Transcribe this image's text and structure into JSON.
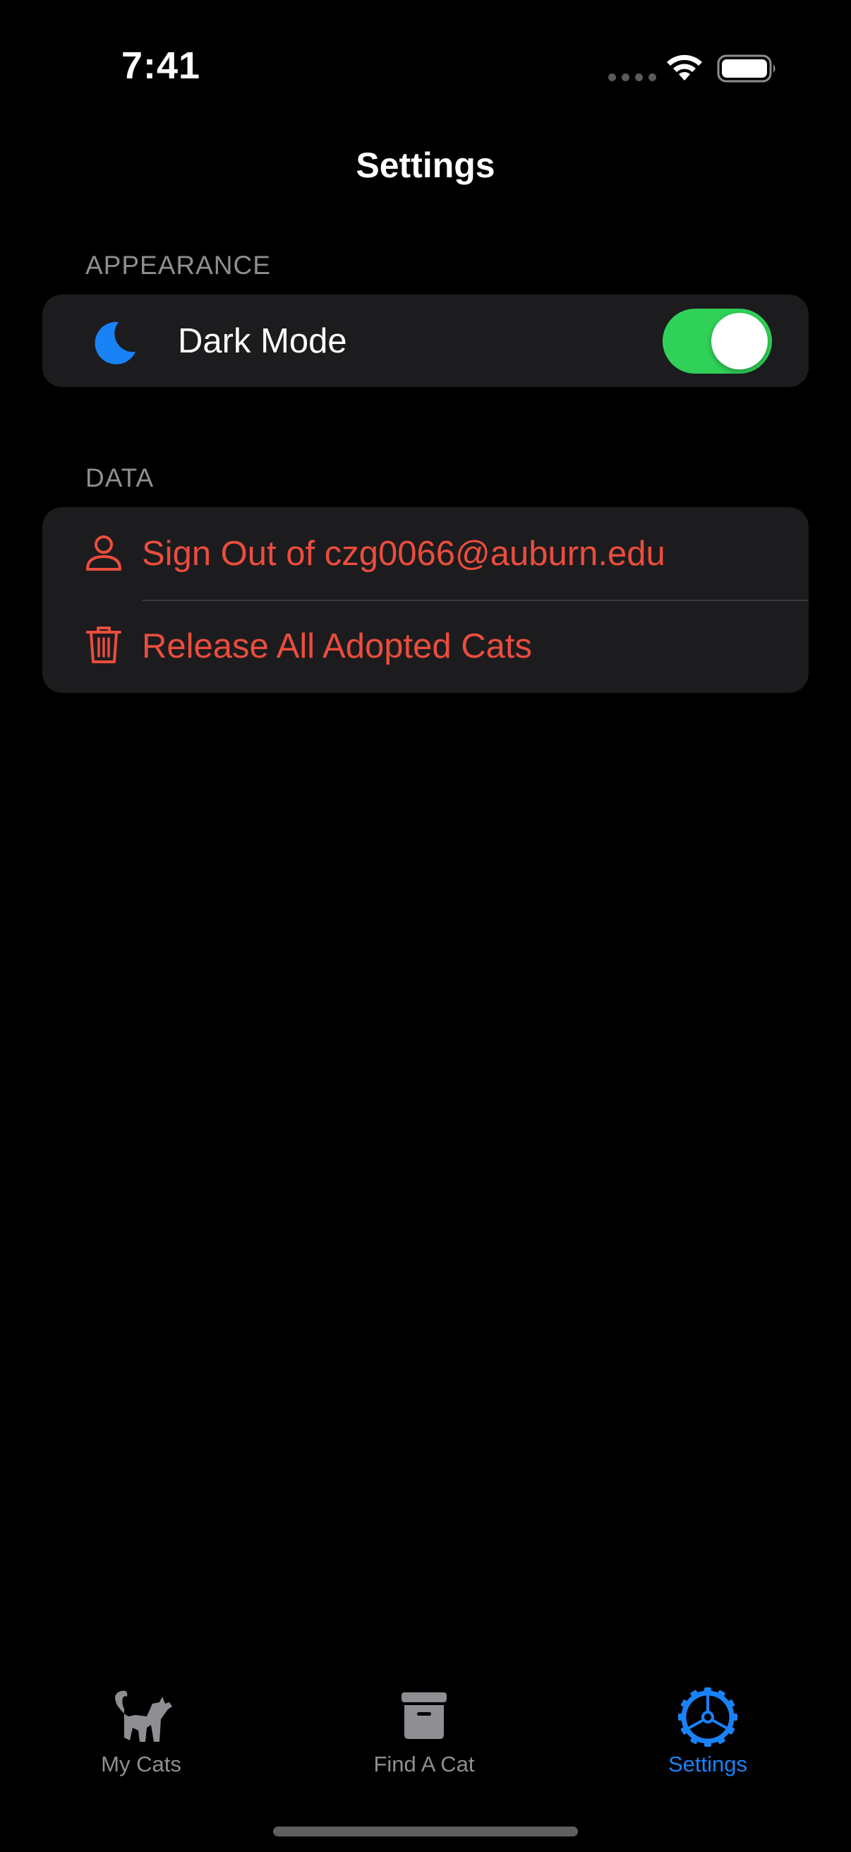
{
  "status_bar": {
    "time": "7:41"
  },
  "nav": {
    "title": "Settings"
  },
  "sections": {
    "appearance": {
      "header": "APPEARANCE",
      "dark_mode": {
        "label": "Dark Mode",
        "icon": "moon-icon",
        "enabled": true
      }
    },
    "data": {
      "header": "DATA",
      "sign_out": {
        "label": "Sign Out of czg0066@auburn.edu",
        "icon": "person-icon"
      },
      "release": {
        "label": "Release All Adopted Cats",
        "icon": "trash-icon"
      }
    }
  },
  "tab_bar": {
    "tabs": [
      {
        "label": "My Cats",
        "icon": "cat-icon",
        "selected": false
      },
      {
        "label": "Find A Cat",
        "icon": "archive-box-icon",
        "selected": false
      },
      {
        "label": "Settings",
        "icon": "gear-icon",
        "selected": true
      }
    ]
  },
  "colors": {
    "background": "#000000",
    "group_background": "#1c1c1e",
    "destructive": "#eb4d3d",
    "accent": "#1a82f7",
    "toggle_on": "#30d158",
    "secondary_text": "#8e8e93"
  }
}
